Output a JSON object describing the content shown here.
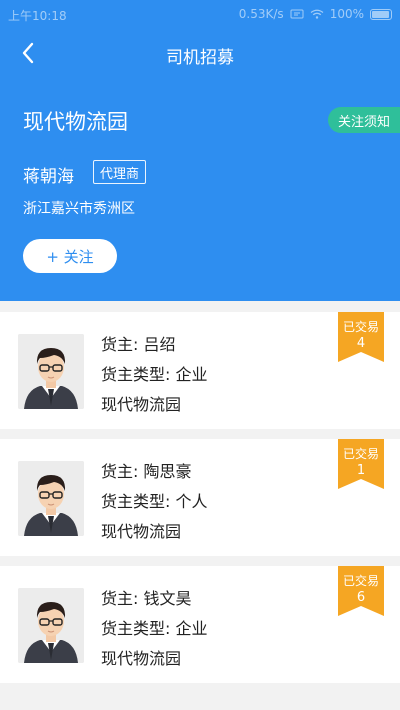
{
  "status_bar": {
    "time": "上午10:18",
    "speed": "0.53K/s",
    "battery": "100%"
  },
  "nav": {
    "title": "司机招募"
  },
  "header": {
    "park_name": "现代物流园",
    "notice_label": "关注须知",
    "agent_name": "蒋朝海",
    "agent_tag": "代理商",
    "location": "浙江嘉兴市秀洲区",
    "follow_label": "+ 关注"
  },
  "colors": {
    "primary": "#2e8ef0",
    "notice": "#2fbf9a",
    "ribbon": "#f5a623"
  },
  "cards": [
    {
      "owner": "货主: 吕绍",
      "owner_type": "货主类型: 企业",
      "park": "现代物流园",
      "ribbon_label": "已交易",
      "ribbon_count": "4"
    },
    {
      "owner": "货主: 陶思豪",
      "owner_type": "货主类型: 个人",
      "park": "现代物流园",
      "ribbon_label": "已交易",
      "ribbon_count": "1"
    },
    {
      "owner": "货主: 钱文昊",
      "owner_type": "货主类型: 企业",
      "park": "现代物流园",
      "ribbon_label": "已交易",
      "ribbon_count": "6"
    }
  ]
}
